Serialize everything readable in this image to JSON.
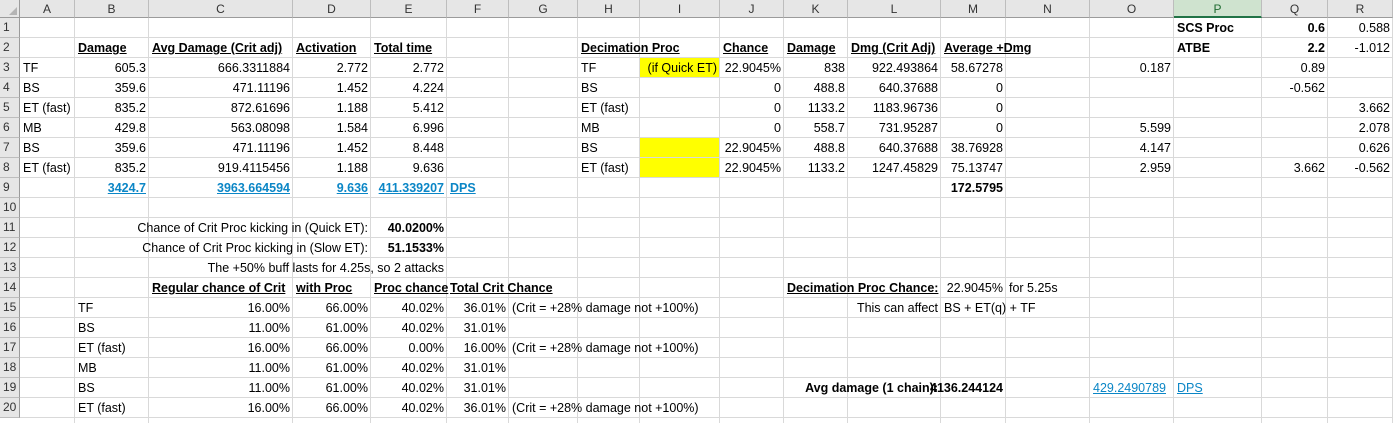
{
  "columns": [
    "A",
    "B",
    "C",
    "D",
    "E",
    "F",
    "G",
    "H",
    "I",
    "J",
    "K",
    "L",
    "M",
    "N",
    "O",
    "P",
    "Q",
    "R"
  ],
  "selected_column": "P",
  "rows": [
    "1",
    "2",
    "3",
    "4",
    "5",
    "6",
    "7",
    "8",
    "9",
    "10",
    "11",
    "12",
    "13",
    "14",
    "15",
    "16",
    "17",
    "18",
    "19",
    "20"
  ],
  "cells": {
    "B2": "Damage",
    "C2": "Avg Damage (Crit adj)",
    "D2": "Activation",
    "E2": "Total time",
    "H2": "Decimation Proc",
    "J2": "Chance",
    "K2": "Damage",
    "L2": "Dmg (Crit Adj)",
    "M2": "Average +Dmg",
    "P1": "SCS Proc",
    "Q1": "0.6",
    "R1": "0.588",
    "P2": "ATBE",
    "Q2": "2.2",
    "R2": "-1.012",
    "A3": "TF",
    "B3": "605.3",
    "C3": "666.3311884",
    "D3": "2.772",
    "E3": "2.772",
    "H3": "TF",
    "I3": "(if Quick ET)",
    "J3": "22.9045%",
    "K3": "838",
    "L3": "922.493864",
    "M3": "58.67278",
    "O3": "0.187",
    "Q3": "0.89",
    "A4": "BS",
    "B4": "359.6",
    "C4": "471.11196",
    "D4": "1.452",
    "E4": "4.224",
    "H4": "BS",
    "J4": "0",
    "K4": "488.8",
    "L4": "640.37688",
    "M4": "0",
    "Q4": "-0.562",
    "A5": "ET (fast)",
    "B5": "835.2",
    "C5": "872.61696",
    "D5": "1.188",
    "E5": "5.412",
    "H5": "ET (fast)",
    "J5": "0",
    "K5": "1133.2",
    "L5": "1183.96736",
    "M5": "0",
    "R5": "3.662",
    "A6": "MB",
    "B6": "429.8",
    "C6": "563.08098",
    "D6": "1.584",
    "E6": "6.996",
    "H6": "MB",
    "J6": "0",
    "K6": "558.7",
    "L6": "731.95287",
    "M6": "0",
    "O6": "5.599",
    "R6": "2.078",
    "A7": "BS",
    "B7": "359.6",
    "C7": "471.11196",
    "D7": "1.452",
    "E7": "8.448",
    "H7": "BS",
    "J7": "22.9045%",
    "K7": "488.8",
    "L7": "640.37688",
    "M7": "38.76928",
    "O7": "4.147",
    "R7": "0.626",
    "A8": "ET (fast)",
    "B8": "835.2",
    "C8": "919.4115456",
    "D8": "1.188",
    "E8": "9.636",
    "H8": "ET (fast)",
    "J8": "22.9045%",
    "K8": "1133.2",
    "L8": "1247.45829",
    "M8": "75.13747",
    "O8": "2.959",
    "Q8": "3.662",
    "R8": "-0.562",
    "B9": "3424.7",
    "C9": "3963.664594",
    "D9": "9.636",
    "E9": "411.339207",
    "F9": "DPS",
    "M9": "172.5795",
    "D11": "Chance of Crit Proc kicking in (Quick ET):",
    "E11": "40.0200%",
    "D12": "Chance of Crit Proc kicking in (Slow ET):",
    "E12": "51.1533%",
    "E13": "The +50% buff lasts for 4.25s, so 2 attacks",
    "C14": "Regular chance of Crit",
    "D14": "with Proc",
    "E14": "Proc chance",
    "F14": "Total Crit Chance",
    "K14": "Decimation Proc Chance:",
    "M14": "22.9045%",
    "N14": "for 5.25s",
    "B15": "TF",
    "C15": "16.00%",
    "D15": "66.00%",
    "E15": "40.02%",
    "F15": "36.01%",
    "G15": "(Crit = +28% damage not +100%)",
    "L15": "This can affect",
    "M15": "BS + ET(q) + TF",
    "B16": "BS",
    "C16": "11.00%",
    "D16": "61.00%",
    "E16": "40.02%",
    "F16": "31.01%",
    "B17": "ET (fast)",
    "C17": "16.00%",
    "D17": "66.00%",
    "E17": "0.00%",
    "F17": "16.00%",
    "G17": "(Crit = +28% damage not +100%)",
    "B18": "MB",
    "C18": "11.00%",
    "D18": "61.00%",
    "E18": "40.02%",
    "F18": "31.01%",
    "B19": "BS",
    "C19": "11.00%",
    "D19": "61.00%",
    "E19": "40.02%",
    "F19": "31.01%",
    "L19": "Avg damage (1 chain):",
    "M19": "4136.244124",
    "O19": "429.2490789",
    "P19": "DPS",
    "B20": "ET (fast)",
    "C20": "16.00%",
    "D20": "66.00%",
    "E20": "40.02%",
    "F20": "36.01%",
    "G20": "(Crit = +28% damage not +100%)"
  },
  "colors": {
    "highlight": "#ffff00",
    "link": "#0b86c6",
    "selected_header": "#217346"
  }
}
